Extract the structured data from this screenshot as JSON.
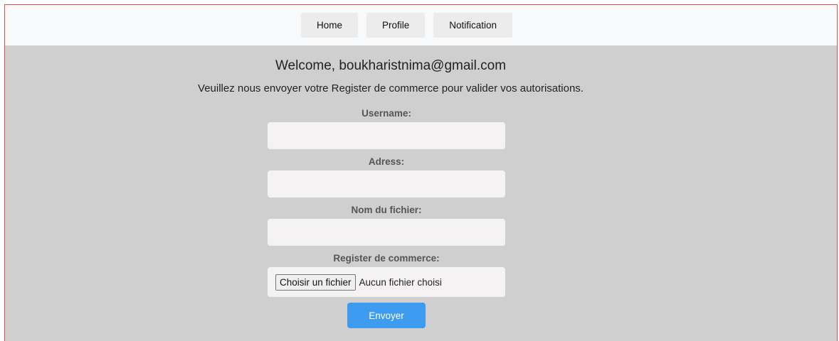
{
  "nav": {
    "items": [
      {
        "label": "Home"
      },
      {
        "label": "Profile"
      },
      {
        "label": "Notification"
      }
    ]
  },
  "main": {
    "welcome": "Welcome, boukharistnima@gmail.com",
    "instructions": "Veuillez nous envoyer votre Register de commerce pour valider vos autorisations."
  },
  "form": {
    "username_label": "Username:",
    "username_value": "",
    "address_label": "Adress:",
    "address_value": "",
    "filename_label": "Nom du fichier:",
    "filename_value": "",
    "register_label": "Register de commerce:",
    "file_button_label": "Choisir un fichier",
    "file_status": "Aucun fichier choisi",
    "submit_label": "Envoyer"
  },
  "colors": {
    "background": "#cfcfcf",
    "navbar": "#f8f9fa",
    "input": "#f4f2f2",
    "submit": "#3d9cf0",
    "frame_border": "#e05050"
  }
}
